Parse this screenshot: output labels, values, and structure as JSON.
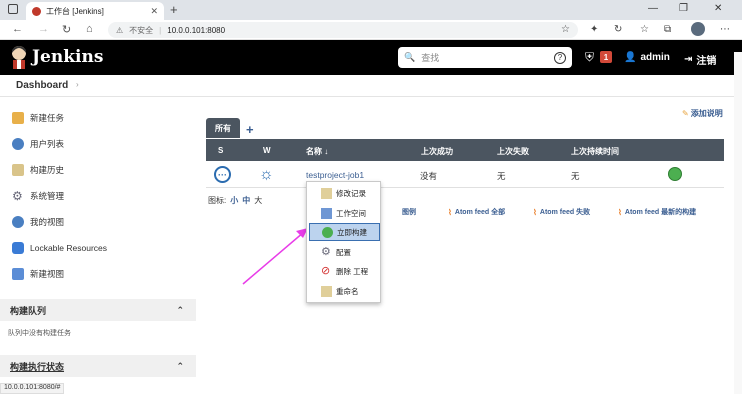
{
  "browser": {
    "tab_title": "工作台 [Jenkins]",
    "address_warning": "不安全",
    "address_url": "10.0.0.101:8080"
  },
  "header": {
    "brand": "Jenkins",
    "search_placeholder": "查找",
    "alerts_count": "1",
    "username": "admin",
    "logout_label": "注销"
  },
  "breadcrumb": {
    "root": "Dashboard"
  },
  "sidebar": {
    "items": [
      {
        "label": "新建任务",
        "icon": "notepad-icon"
      },
      {
        "label": "用户列表",
        "icon": "users-icon"
      },
      {
        "label": "构建历史",
        "icon": "history-icon"
      },
      {
        "label": "系统管理",
        "icon": "gear-icon"
      },
      {
        "label": "我的视图",
        "icon": "user-views-icon"
      },
      {
        "label": "Lockable Resources",
        "icon": "network-icon"
      },
      {
        "label": "新建视图",
        "icon": "folder-icon"
      }
    ],
    "queue_title": "构建队列",
    "queue_empty": "队列中没有构建任务",
    "executors_title": "构建执行状态"
  },
  "main": {
    "add_description": "添加说明",
    "view_tab": "所有",
    "view_add": "+",
    "columns": {
      "s": "S",
      "w": "W",
      "name": "名称 ↓",
      "last_success": "上次成功",
      "last_failure": "上次失败",
      "last_duration": "上次持续时间"
    },
    "job": {
      "name": "testproject-job1",
      "last_success": "没有",
      "last_failure": "无",
      "last_duration": "无"
    },
    "icon_label": "图标:",
    "icon_sizes": [
      "小",
      "中",
      "大"
    ],
    "legend": "图例",
    "feeds": [
      "Atom feed 全部",
      "Atom feed 失败",
      "Atom feed 最新的构建"
    ]
  },
  "context_menu": {
    "items": [
      "修改记录",
      "工作空间",
      "立即构建",
      "配置",
      "删除 工程",
      "重命名"
    ],
    "selected": "立即构建"
  },
  "status_bar": "10.0.0.101:8080/#"
}
